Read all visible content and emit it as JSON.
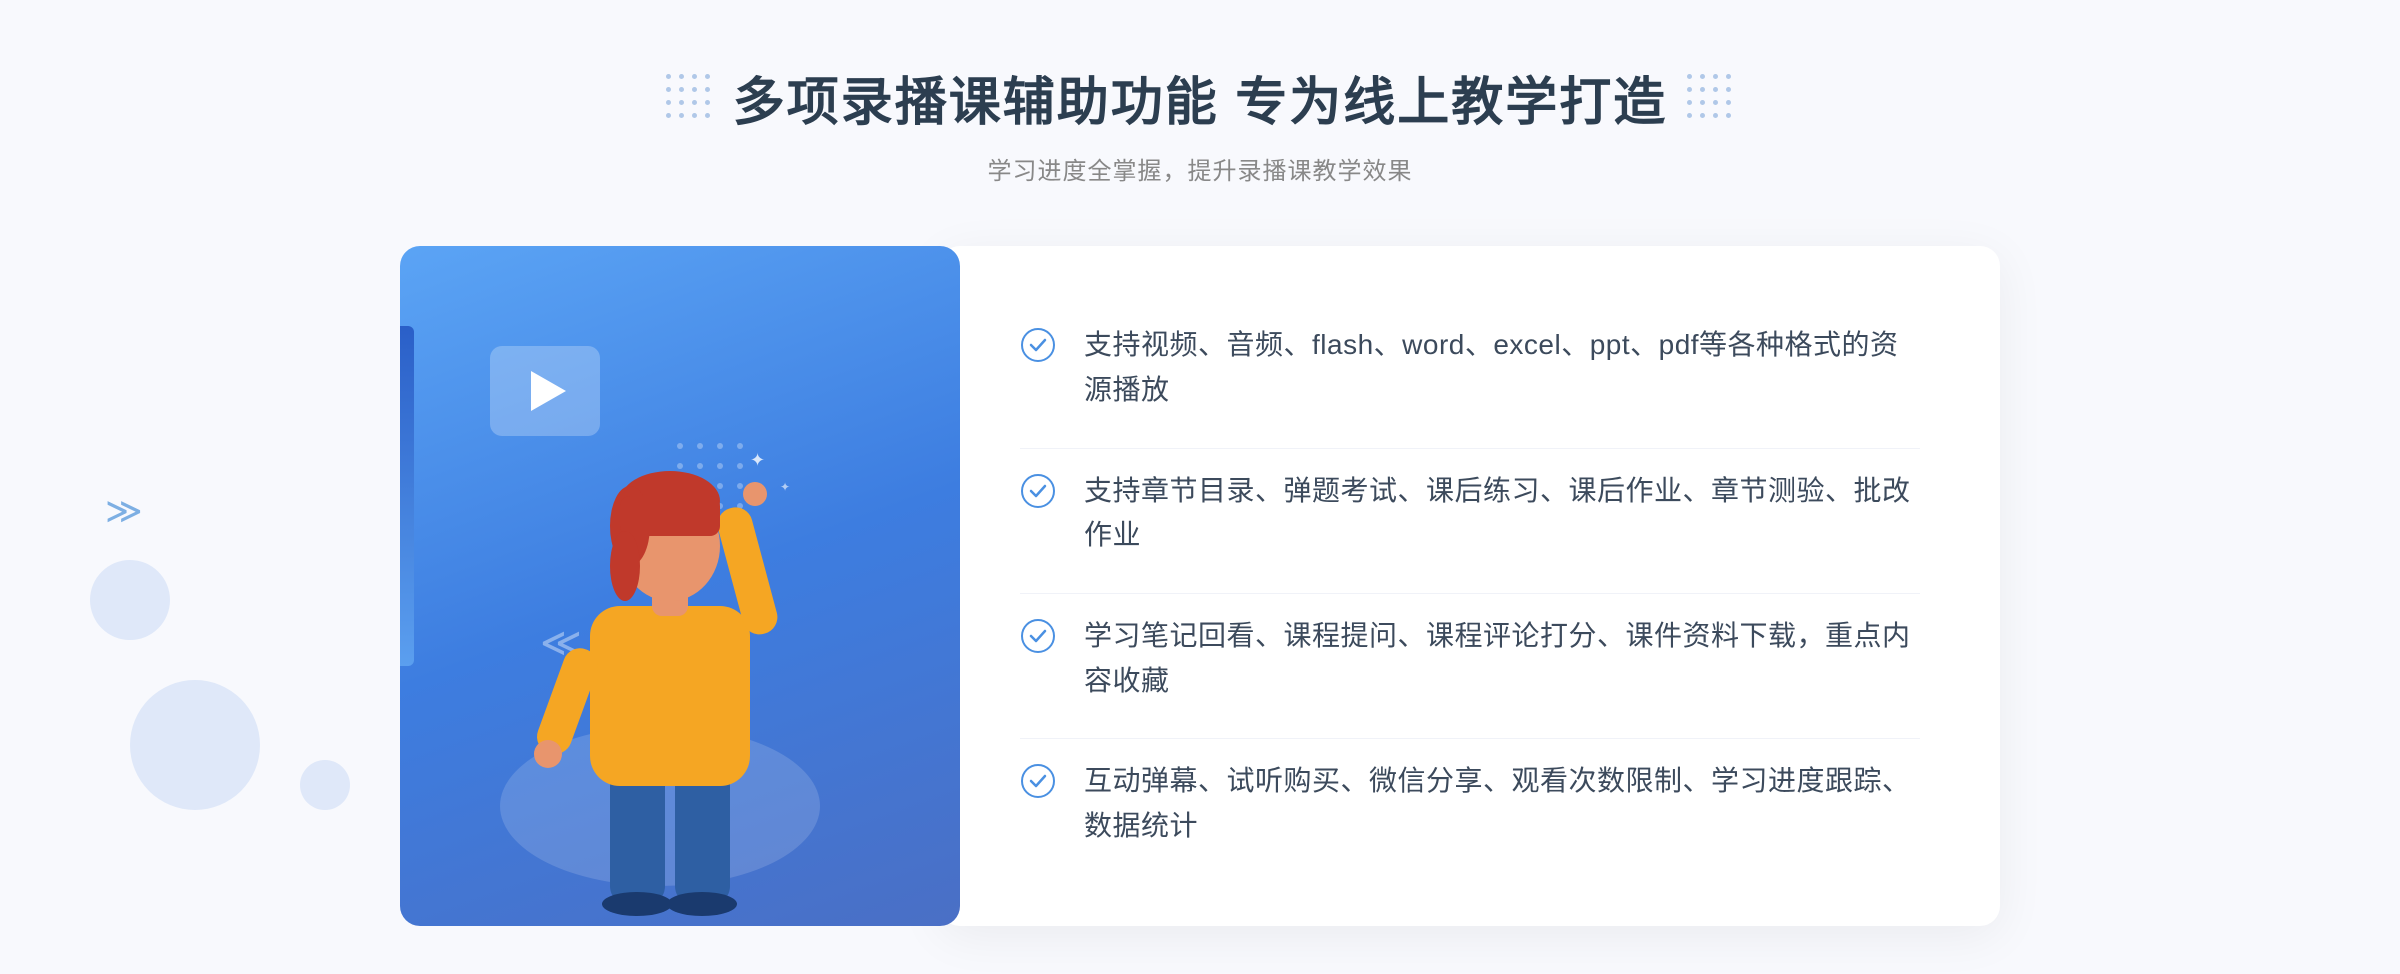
{
  "header": {
    "title": "多项录播课辅助功能 专为线上教学打造",
    "subtitle": "学习进度全掌握，提升录播课教学效果",
    "title_dots_left": "decorative",
    "title_dots_right": "decorative"
  },
  "features": [
    {
      "id": 1,
      "text": "支持视频、音频、flash、word、excel、ppt、pdf等各种格式的资源播放"
    },
    {
      "id": 2,
      "text": "支持章节目录、弹题考试、课后练习、课后作业、章节测验、批改作业"
    },
    {
      "id": 3,
      "text": "学习笔记回看、课程提问、课程评论打分、课件资料下载，重点内容收藏"
    },
    {
      "id": 4,
      "text": "互动弹幕、试听购买、微信分享、观看次数限制、学习进度跟踪、数据统计"
    }
  ],
  "illustration": {
    "play_icon": "▶",
    "card_gradient_start": "#5ba4f5",
    "card_gradient_end": "#4a6fc5"
  },
  "colors": {
    "primary_blue": "#4a90e2",
    "text_dark": "#2c3e50",
    "text_gray": "#888888",
    "bg_light": "#f8f9fd",
    "white": "#ffffff"
  }
}
